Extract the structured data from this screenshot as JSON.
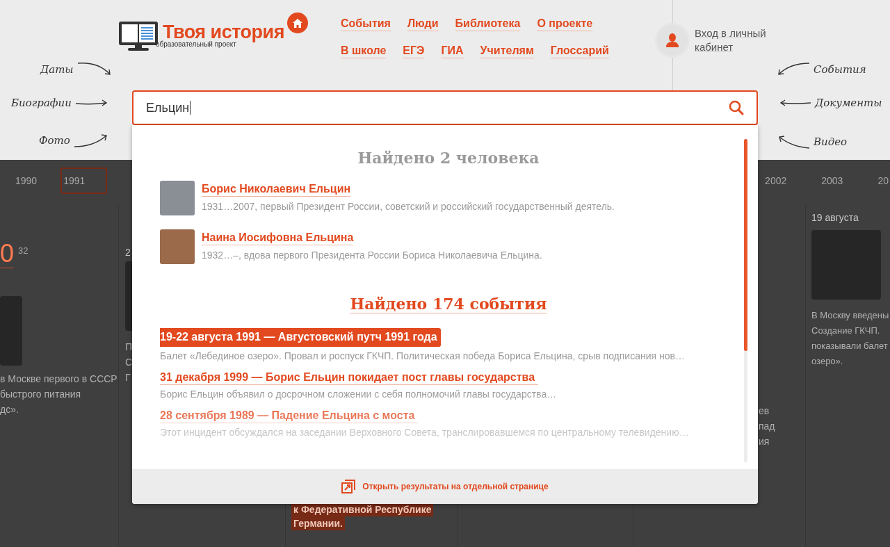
{
  "header": {
    "logo": {
      "title": "Твоя история",
      "subtitle": "образовательный проект"
    },
    "nav_rows": [
      [
        "События",
        "Люди",
        "Библиотека",
        "О проекте"
      ],
      [
        "В школе",
        "ЕГЭ",
        "ГИА",
        "Учителям",
        "Глоссарий"
      ]
    ],
    "login": "Вход в личный кабинет"
  },
  "hints_left": [
    "Даты",
    "Биографии",
    "Фото"
  ],
  "hints_right": [
    "События",
    "Документы",
    "Видео"
  ],
  "search": {
    "value": "Ельцин"
  },
  "timeline": {
    "years_left": [
      {
        "label": "1990",
        "selected": false
      },
      {
        "label": "1991",
        "selected": true
      }
    ],
    "years_right": [
      {
        "label": "2002",
        "selected": false
      },
      {
        "label": "2003",
        "selected": false
      },
      {
        "label": "20",
        "selected": false
      }
    ],
    "columns": [
      {
        "big_date": "0",
        "date_sup": "32",
        "photo": true,
        "lines": [
          "в Москве первого в СССР",
          "быстрого питания",
          "дс»."
        ]
      },
      {
        "date": "2",
        "photo": true,
        "lines": [
          "П",
          "С",
          "Г"
        ]
      },
      {
        "highlight_lines": [
          "к Федеративной Республике",
          "Германии."
        ]
      },
      {},
      {
        "lines": [
          "ев",
          "пад",
          "ия"
        ]
      },
      {
        "date": "19 августа",
        "photo": true,
        "lines": [
          "В Москву введены",
          "Создание ГКЧП.",
          "показывали балет",
          "озеро»."
        ]
      }
    ]
  },
  "results": {
    "people_title": "Найдено 2 человека",
    "people": [
      {
        "name": "Борис Николаевич Ельцин",
        "desc": "1931…2007, первый Президент России, советский и российский государственный деятель."
      },
      {
        "name": "Наина Иосифовна Ельцина",
        "desc": "1932…–,  вдова первого Президента России Бориса Николаевича Ельцина."
      }
    ],
    "events_title": "Найдено 174 события",
    "events": [
      {
        "heading": "19-22 августа 1991 — Августовский путч 1991 года",
        "desc": "Балет «Лебединое озеро». Провал и роспуск ГКЧП. Политическая победа Бориса Ельцина, срыв подписания нов…",
        "selected": true
      },
      {
        "heading": "31 декабря 1999 — Борис Ельцин покидает пост главы государства",
        "desc": "Борис Ельцин объявил о досрочном сложении с себя полномочий главы государства…",
        "selected": false
      },
      {
        "heading": "28 сентября 1989 — Падение Ельцина с моста",
        "desc": "Этот инцидент обсуждался на заседании Верховного Совета, транслировавшемся по центральному телевидению…",
        "selected": false
      }
    ],
    "footer_link": "Открыть результаты на отдельной странице"
  }
}
